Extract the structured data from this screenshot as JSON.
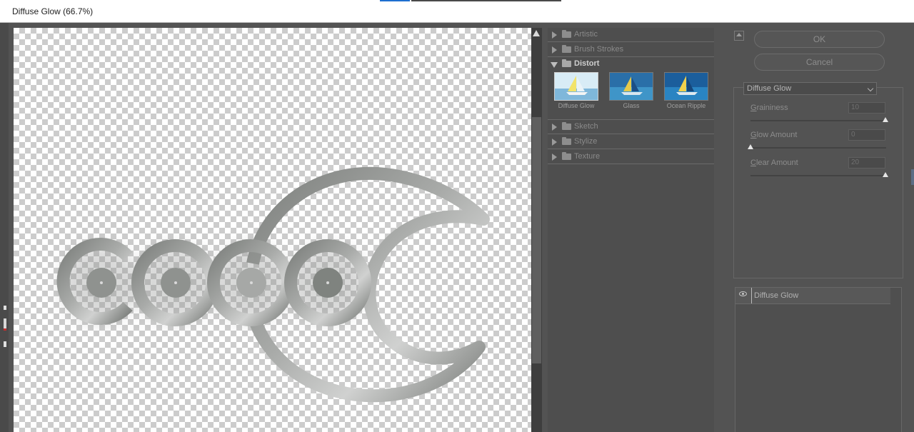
{
  "window": {
    "title": "Diffuse Glow (66.7%)"
  },
  "gallery": {
    "categories": [
      {
        "label": "Artistic",
        "expanded": false
      },
      {
        "label": "Brush Strokes",
        "expanded": false
      },
      {
        "label": "Distort",
        "expanded": true
      },
      {
        "label": "Sketch",
        "expanded": false
      },
      {
        "label": "Stylize",
        "expanded": false
      },
      {
        "label": "Texture",
        "expanded": false
      }
    ],
    "thumbnails": [
      {
        "label": "Diffuse Glow",
        "selected": true
      },
      {
        "label": "Glass",
        "selected": false
      },
      {
        "label": "Ocean Ripple",
        "selected": false
      }
    ]
  },
  "buttons": {
    "ok": "OK",
    "cancel": "Cancel"
  },
  "filter_select": {
    "value": "Diffuse Glow"
  },
  "sliders": [
    {
      "label_key": "G",
      "label_rest": "raininess",
      "value": "10",
      "fraction": 1.0
    },
    {
      "label_key": "G",
      "label_rest": "low Amount",
      "value": "0",
      "fraction": 0.0
    },
    {
      "label_key": "C",
      "label_rest": "lear Amount",
      "value": "20",
      "fraction": 1.0
    }
  ],
  "layers": {
    "item": "Diffuse Glow"
  },
  "colors": {
    "panel": "#535353",
    "gallery": "#4e4e4e",
    "titlebar": "#ffffff",
    "logo_metal": "#8a8d8a"
  },
  "icons": [
    "folder-icon",
    "expand-triangle-icon",
    "eye-icon",
    "collapse-icon",
    "chevron-down-icon"
  ]
}
